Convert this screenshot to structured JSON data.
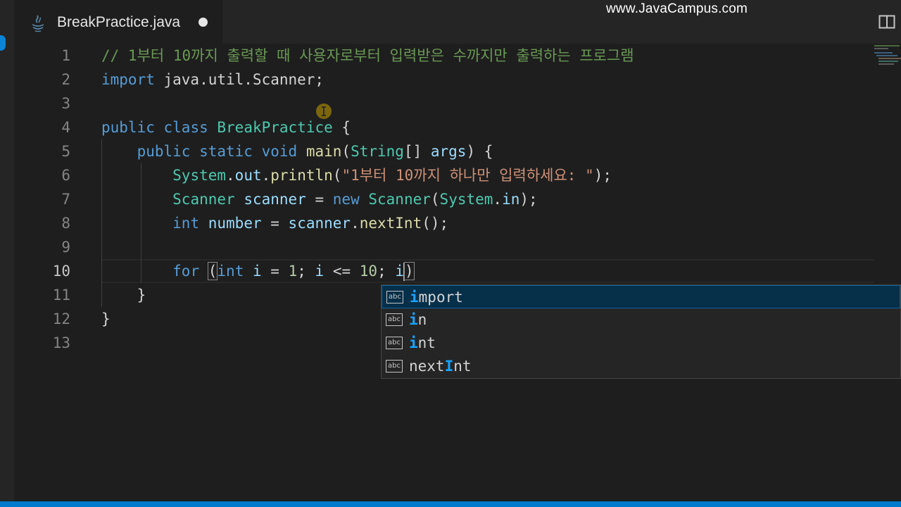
{
  "tab": {
    "title": "BreakPractice.java",
    "icon": "java-file-icon",
    "dirty": true
  },
  "watermark": "www.JavaCampus.com",
  "editor": {
    "line_numbers": [
      "1",
      "2",
      "3",
      "4",
      "5",
      "6",
      "7",
      "8",
      "9",
      "10",
      "11",
      "12",
      "13"
    ],
    "active_line": "10",
    "lines": {
      "l1_comment": "// 1부터 10까지 출력할 때 사용자로부터 입력받은 수까지만 출력하는 프로그램",
      "l2_import_kw": "import",
      "l2_import_rest": " java.util.Scanner;",
      "l4_public": "public",
      "l4_class": "class",
      "l4_name": "BreakPractice",
      "l4_brace": " {",
      "l5_public": "public",
      "l5_static": "static",
      "l5_void": "void",
      "l5_main": "main",
      "l5_paren": "(",
      "l5_string": "String",
      "l5_arr": "[] ",
      "l5_args": "args",
      "l5_close": ") {",
      "l6_system": "System",
      "l6_dot1": ".",
      "l6_out": "out",
      "l6_dot2": ".",
      "l6_println": "println",
      "l6_open": "(",
      "l6_string": "\"1부터 10까지 하나만 입력하세요: \"",
      "l6_close": ");",
      "l7_type": "Scanner",
      "l7_var": "scanner",
      "l7_eq": " = ",
      "l7_new": "new",
      "l7_ctor": "Scanner",
      "l7_open": "(",
      "l7_system": "System",
      "l7_dot": ".",
      "l7_in": "in",
      "l7_close": ");",
      "l8_int": "int",
      "l8_var": "number",
      "l8_eq": " = ",
      "l8_scanner": "scanner",
      "l8_dot": ".",
      "l8_call": "nextInt",
      "l8_close": "();",
      "l10_for": "for",
      "l10_open": "(",
      "l10_int": "int",
      "l10_i1": "i",
      "l10_eq": " = ",
      "l10_one": "1",
      "l10_semi1": "; ",
      "l10_i2": "i",
      "l10_le": " <= ",
      "l10_ten": "10",
      "l10_semi2": "; ",
      "l10_i3": "i",
      "l10_closeparen": ")",
      "l11_brace": "}",
      "l12_brace": "}"
    }
  },
  "suggestions": {
    "icon": "abc",
    "selected_index": 0,
    "items": [
      {
        "match": "i",
        "rest": "mport"
      },
      {
        "match": "i",
        "rest": "n"
      },
      {
        "match": "i",
        "rest": "nt"
      },
      {
        "pre": "next",
        "match": "I",
        "rest": "nt"
      }
    ]
  },
  "colors": {
    "background": "#1e1e1e",
    "keyword": "#569cd6",
    "type": "#4ec9b0",
    "function": "#dcdcaa",
    "string": "#ce9178",
    "comment": "#6a9955",
    "number": "#b5cea8",
    "variable": "#9cdcfe",
    "status_bar": "#007acc",
    "suggest_highlight": "#18a3ff"
  }
}
